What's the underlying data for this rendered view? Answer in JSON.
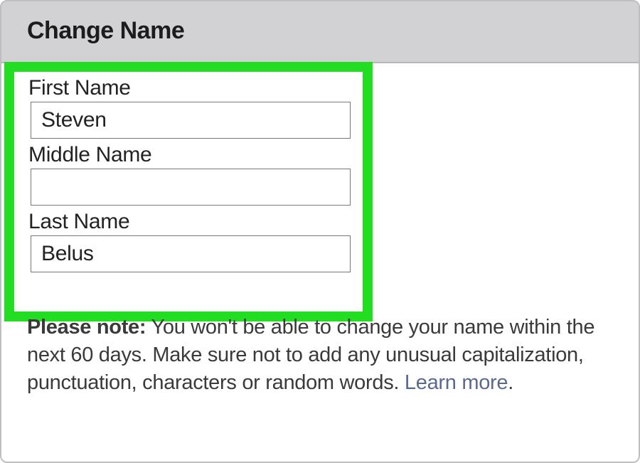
{
  "header": {
    "title": "Change Name"
  },
  "form": {
    "first_name": {
      "label": "First Name",
      "value": "Steven"
    },
    "middle_name": {
      "label": "Middle Name",
      "value": ""
    },
    "last_name": {
      "label": "Last Name",
      "value": "Belus"
    }
  },
  "note": {
    "bold_prefix": "Please note:",
    "body": " You won't be able to change your name within the next 60 days. Make sure not to add any unusual capitalization, punctuation, characters or random words. ",
    "learn_more": "Learn more",
    "period": "."
  }
}
